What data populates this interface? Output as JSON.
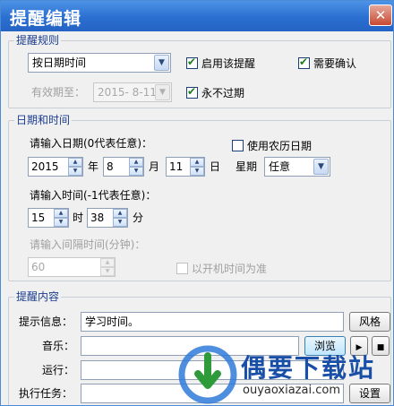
{
  "window": {
    "title": "提醒编辑",
    "close_glyph": "✕"
  },
  "rules": {
    "group_label": "提醒规则",
    "mode_select": "按日期时间",
    "enable_reminder": {
      "label": "启用该提醒",
      "checked": true
    },
    "need_confirm": {
      "label": "需要确认",
      "checked": true
    },
    "valid_until_label": "有效期至：",
    "valid_until_value": "2015- 8-11",
    "never_expire": {
      "label": "永不过期",
      "checked": true
    }
  },
  "datetime": {
    "group_label": "日期和时间",
    "date_prompt": "请输入日期(0代表任意)：",
    "lunar": {
      "label": "使用农历日期",
      "checked": false
    },
    "year": "2015",
    "year_unit": "年",
    "month": "8",
    "month_unit": "月",
    "day": "11",
    "day_unit": "日",
    "weekday_label": "星期",
    "weekday_value": "任意",
    "time_prompt": "请输入时间(-1代表任意)：",
    "hour": "15",
    "hour_unit": "时",
    "minute": "38",
    "minute_unit": "分",
    "interval_prompt": "请输入间隔时间(分钟)：",
    "interval_value": "60",
    "boot_time": {
      "label": "以开机时间为准",
      "checked": false
    }
  },
  "content": {
    "group_label": "提醒内容",
    "tip_label": "提示信息：",
    "tip_value": "学习时间。",
    "style_button": "风格",
    "music_label": "音乐：",
    "music_value": "",
    "browse_button": "浏览",
    "play_glyph": "▶",
    "stop_glyph": "■",
    "run_label": "运行：",
    "run_value": "",
    "task_label": "执行任务：",
    "task_value": "",
    "settings_button": "设置"
  },
  "watermark": {
    "brand": "偶要下载站",
    "url": "ouyaoxiazai.com"
  },
  "colors": {
    "titlebar": "#2a6fd0",
    "group_label": "#1a3d8f",
    "watermark": "#1a4fa8"
  }
}
